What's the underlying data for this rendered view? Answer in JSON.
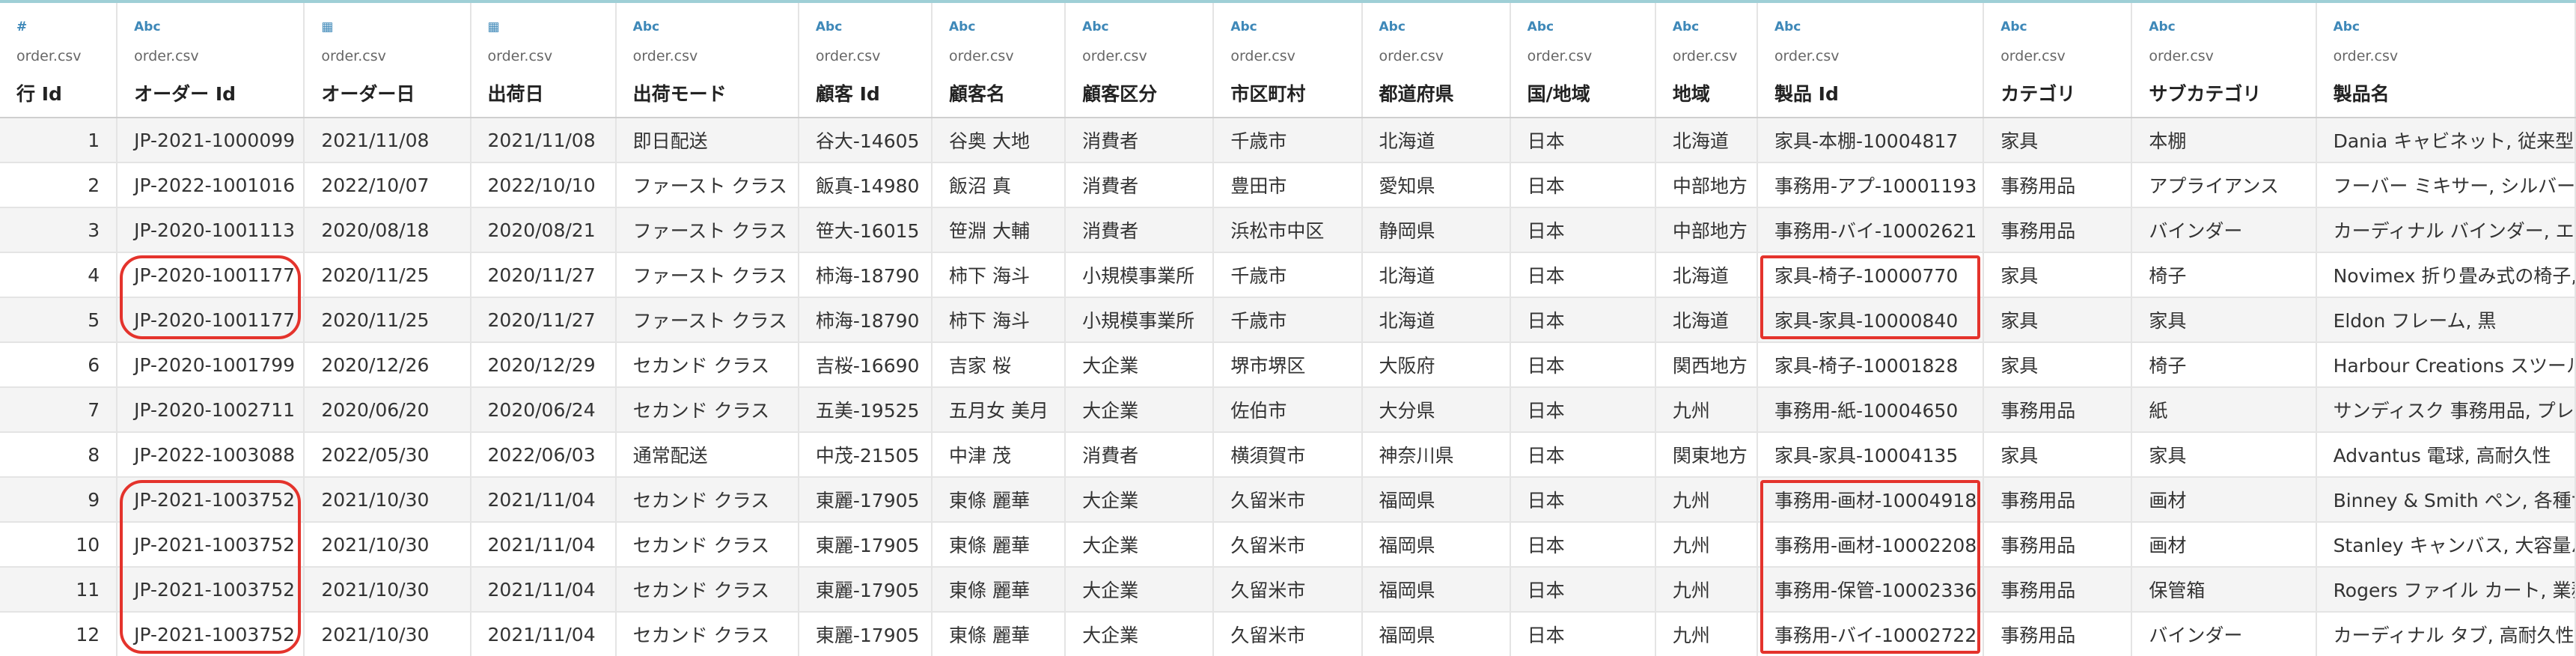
{
  "source": "order.csv",
  "columns": [
    {
      "icon": "#",
      "name": "行 Id"
    },
    {
      "icon": "Abc",
      "name": "オーダー Id"
    },
    {
      "icon": "▦",
      "name": "オーダー日"
    },
    {
      "icon": "▦",
      "name": "出荷日"
    },
    {
      "icon": "Abc",
      "name": "出荷モード"
    },
    {
      "icon": "Abc",
      "name": "顧客 Id"
    },
    {
      "icon": "Abc",
      "name": "顧客名"
    },
    {
      "icon": "Abc",
      "name": "顧客区分"
    },
    {
      "icon": "Abc",
      "name": "市区町村"
    },
    {
      "icon": "Abc",
      "name": "都道府県"
    },
    {
      "icon": "Abc",
      "name": "国/地域"
    },
    {
      "icon": "Abc",
      "name": "地域"
    },
    {
      "icon": "Abc",
      "name": "製品 Id"
    },
    {
      "icon": "Abc",
      "name": "カテゴリ"
    },
    {
      "icon": "Abc",
      "name": "サブカテゴリ"
    },
    {
      "icon": "Abc",
      "name": "製品名"
    }
  ],
  "rows": [
    [
      "1",
      "JP-2021-1000099",
      "2021/11/08",
      "2021/11/08",
      "即日配送",
      "谷大-14605",
      "谷奥 大地",
      "消費者",
      "千歳市",
      "北海道",
      "日本",
      "北海道",
      "家具-本棚-10004817",
      "家具",
      "本棚",
      "Dania キャビネット, 従来型"
    ],
    [
      "2",
      "JP-2022-1001016",
      "2022/10/07",
      "2022/10/10",
      "ファースト クラス",
      "飯真-14980",
      "飯沼 真",
      "消費者",
      "豊田市",
      "愛知県",
      "日本",
      "中部地方",
      "事務用-アプ-10001193",
      "事務用品",
      "アプライアンス",
      "フーバー ミキサー, シルバー"
    ],
    [
      "3",
      "JP-2020-1001113",
      "2020/08/18",
      "2020/08/21",
      "ファースト クラス",
      "笹大-16015",
      "笹淵 大輔",
      "消費者",
      "浜松市中区",
      "静岡県",
      "日本",
      "中部地方",
      "事務用-バイ-10002621",
      "事務用品",
      "バインダー",
      "カーディナル バインダー, エコ"
    ],
    [
      "4",
      "JP-2020-1001177",
      "2020/11/25",
      "2020/11/27",
      "ファースト クラス",
      "柿海-18790",
      "柿下 海斗",
      "小規模事業所",
      "千歳市",
      "北海道",
      "日本",
      "北海道",
      "家具-椅子-10000770",
      "家具",
      "椅子",
      "Novimex 折り畳み式の椅子, 赤"
    ],
    [
      "5",
      "JP-2020-1001177",
      "2020/11/25",
      "2020/11/27",
      "ファースト クラス",
      "柿海-18790",
      "柿下 海斗",
      "小規模事業所",
      "千歳市",
      "北海道",
      "日本",
      "北海道",
      "家具-家具-10000840",
      "家具",
      "家具",
      "Eldon フレーム, 黒"
    ],
    [
      "6",
      "JP-2020-1001799",
      "2020/12/26",
      "2020/12/29",
      "セカンド クラス",
      "吉桜-16690",
      "吉家 桜",
      "大企業",
      "堺市堺区",
      "大阪府",
      "日本",
      "関西地方",
      "家具-椅子-10001828",
      "家具",
      "椅子",
      "Harbour Creations スツール, 赤"
    ],
    [
      "7",
      "JP-2020-1002711",
      "2020/06/20",
      "2020/06/24",
      "セカンド クラス",
      "五美-19525",
      "五月女 美月",
      "大企業",
      "佐伯市",
      "大分県",
      "日本",
      "九州",
      "事務用-紙-10004650",
      "事務用品",
      "紙",
      "サンディスク 事務用品, プレミアム"
    ],
    [
      "8",
      "JP-2022-1003088",
      "2022/05/30",
      "2022/06/03",
      "通常配送",
      "中茂-21505",
      "中津 茂",
      "消費者",
      "横須賀市",
      "神奈川県",
      "日本",
      "関東地方",
      "家具-家具-10004135",
      "家具",
      "家具",
      "Advantus 電球, 高耐久性"
    ],
    [
      "9",
      "JP-2021-1003752",
      "2021/10/30",
      "2021/11/04",
      "セカンド クラス",
      "東麗-17905",
      "東條 麗華",
      "大企業",
      "久留米市",
      "福岡県",
      "日本",
      "九州",
      "事務用-画材-10004918",
      "事務用品",
      "画材",
      "Binney & Smith ペン, 各種サイズ"
    ],
    [
      "10",
      "JP-2021-1003752",
      "2021/10/30",
      "2021/11/04",
      "セカンド クラス",
      "東麗-17905",
      "東條 麗華",
      "大企業",
      "久留米市",
      "福岡県",
      "日本",
      "九州",
      "事務用-画材-10002208",
      "事務用品",
      "画材",
      "Stanley キャンバス, 大容量パック"
    ],
    [
      "11",
      "JP-2021-1003752",
      "2021/10/30",
      "2021/11/04",
      "セカンド クラス",
      "東麗-17905",
      "東條 麗華",
      "大企業",
      "久留米市",
      "福岡県",
      "日本",
      "九州",
      "事務用-保管-10002336",
      "事務用品",
      "保管箱",
      "Rogers ファイル カート, 業務用"
    ],
    [
      "12",
      "JP-2021-1003752",
      "2021/10/30",
      "2021/11/04",
      "セカンド クラス",
      "東麗-17905",
      "東條 麗華",
      "大企業",
      "久留米市",
      "福岡県",
      "日本",
      "九州",
      "事務用-バイ-10002722",
      "事務用品",
      "バインダー",
      "カーディナル タブ, 高耐久性"
    ]
  ],
  "highlight_color": "#e4332c",
  "highlights": [
    {
      "label": "order-id-rows-4-5",
      "column": "オーダー Id",
      "rows": [
        "4",
        "5"
      ]
    },
    {
      "label": "product-id-rows-4-5",
      "column": "製品 Id",
      "rows": [
        "4",
        "5"
      ]
    },
    {
      "label": "order-id-rows-9-12",
      "column": "オーダー Id",
      "rows": [
        "9",
        "10",
        "11",
        "12"
      ]
    },
    {
      "label": "product-id-rows-9-12",
      "column": "製品 Id",
      "rows": [
        "9",
        "10",
        "11",
        "12"
      ]
    }
  ]
}
